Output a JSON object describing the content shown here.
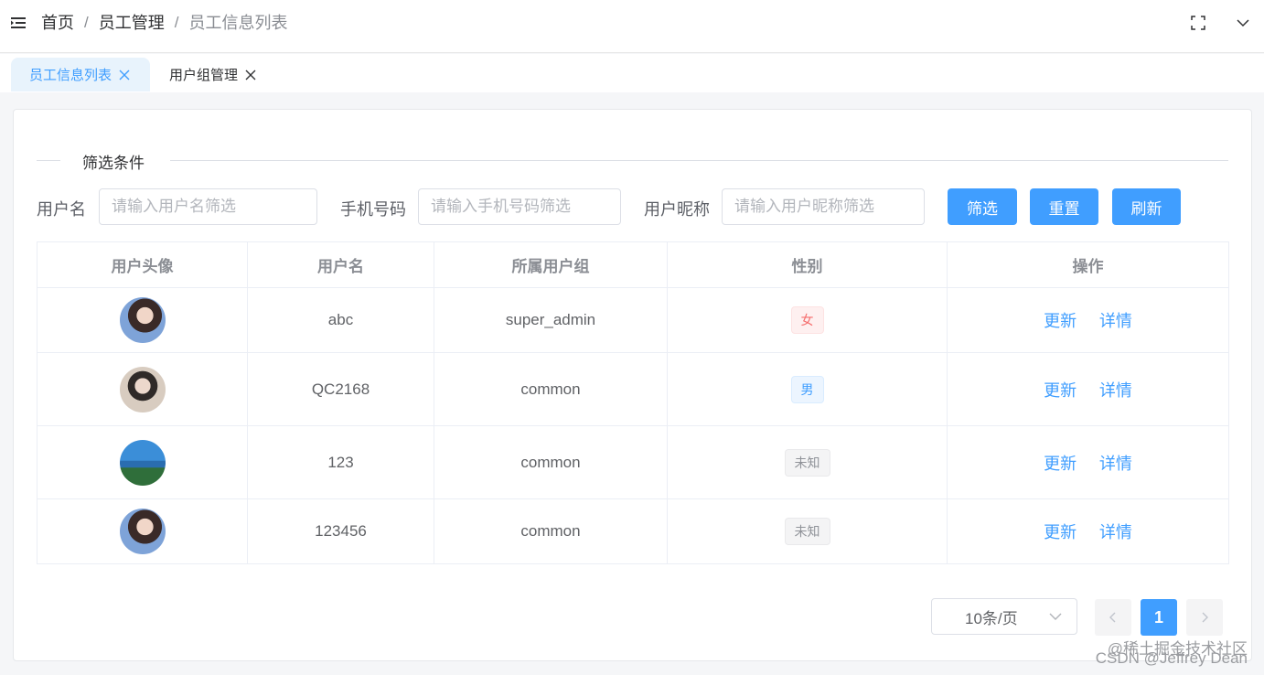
{
  "breadcrumb": {
    "items": [
      "首页",
      "员工管理",
      "员工信息列表"
    ],
    "separator": "/"
  },
  "tabs": [
    {
      "label": "员工信息列表",
      "active": true
    },
    {
      "label": "用户组管理",
      "active": false
    }
  ],
  "filter": {
    "title": "筛选条件",
    "username_label": "用户名",
    "username_placeholder": "请输入用户名筛选",
    "phone_label": "手机号码",
    "phone_placeholder": "请输入手机号码筛选",
    "nickname_label": "用户昵称",
    "nickname_placeholder": "请输入用户昵称筛选",
    "filter_button": "筛选",
    "reset_button": "重置",
    "refresh_button": "刷新"
  },
  "table": {
    "headers": [
      "用户头像",
      "用户名",
      "所属用户组",
      "性别",
      "操作"
    ],
    "rows": [
      {
        "username": "abc",
        "group": "super_admin",
        "gender": "女",
        "gender_type": "female",
        "update": "更新",
        "detail": "详情"
      },
      {
        "username": "QC2168",
        "group": "common",
        "gender": "男",
        "gender_type": "male",
        "update": "更新",
        "detail": "详情"
      },
      {
        "username": "123",
        "group": "common",
        "gender": "未知",
        "gender_type": "unknown",
        "update": "更新",
        "detail": "详情"
      },
      {
        "username": "123456",
        "group": "common",
        "gender": "未知",
        "gender_type": "unknown",
        "update": "更新",
        "detail": "详情"
      }
    ]
  },
  "pagination": {
    "page_size": "10条/页",
    "current_page": "1"
  },
  "watermark": {
    "line1": "@稀土掘金技术社区",
    "line2": "CSDN @Jeffrey Dean"
  },
  "colors": {
    "primary": "#409eff",
    "female": "#f56c6c",
    "unknown": "#909399"
  }
}
